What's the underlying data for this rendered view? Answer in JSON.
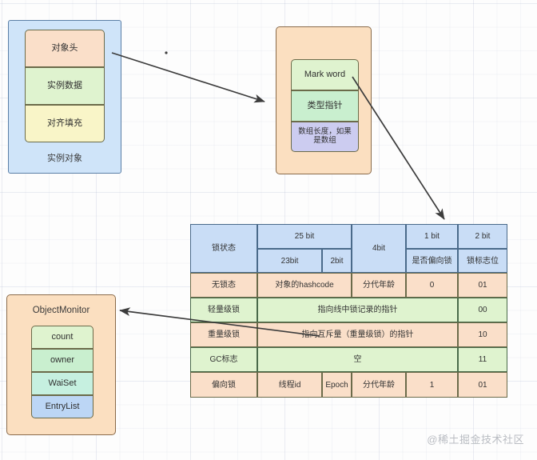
{
  "diagram": {
    "instance_object": {
      "title": "实例对象",
      "rows": [
        {
          "label": "对象头"
        },
        {
          "label": "实例数据"
        },
        {
          "label": "对齐填充"
        }
      ]
    },
    "object_header": {
      "rows": [
        {
          "label": "Mark  word"
        },
        {
          "label": "类型指针"
        },
        {
          "label": "数组长度，如果是数组"
        }
      ]
    },
    "object_monitor": {
      "title": "ObjectMonitor",
      "rows": [
        {
          "label": "count"
        },
        {
          "label": "owner"
        },
        {
          "label": "WaiSet"
        },
        {
          "label": "EntryList"
        }
      ]
    },
    "mark_word_table": {
      "header": {
        "lock_state": "锁状态",
        "bits_25": "25 bit",
        "bits_23": "23bit",
        "bits_2": "2bit",
        "bits_4": "4bit",
        "bits_1": "1 bit",
        "bits_1_sub": "是否偏向锁",
        "bits_2_tail": "2 bit",
        "bits_2_tail_sub": "锁标志位"
      },
      "rows": [
        {
          "state": "无锁态",
          "c1": "对象的hashcode",
          "c2": "分代年龄",
          "bias": "0",
          "flag": "01"
        },
        {
          "state": "轻量级锁",
          "span": "指向线中锁记录的指针",
          "flag": "00"
        },
        {
          "state": "重量级锁",
          "span": "指向互斥量（重量级锁）的指针",
          "flag": "10"
        },
        {
          "state": "GC标志",
          "span": "空",
          "flag": "11"
        },
        {
          "state": "偏向锁",
          "thread": "线程id",
          "epoch": "Epoch",
          "age": "分代年龄",
          "bias": "1",
          "flag": "01"
        }
      ]
    },
    "watermark": "@稀土掘金技术社区"
  },
  "colors": {
    "blue_fill": "#cfe4f9",
    "orange_fill": "#fbdfc0",
    "peach": "#fadfc9",
    "green_light": "#dff3cf",
    "green_mid": "#c9efcf",
    "yellow": "#f9f5c8",
    "purple": "#ccccf0",
    "teal": "#c6f0e0",
    "header_blue": "#c9ddf6"
  }
}
